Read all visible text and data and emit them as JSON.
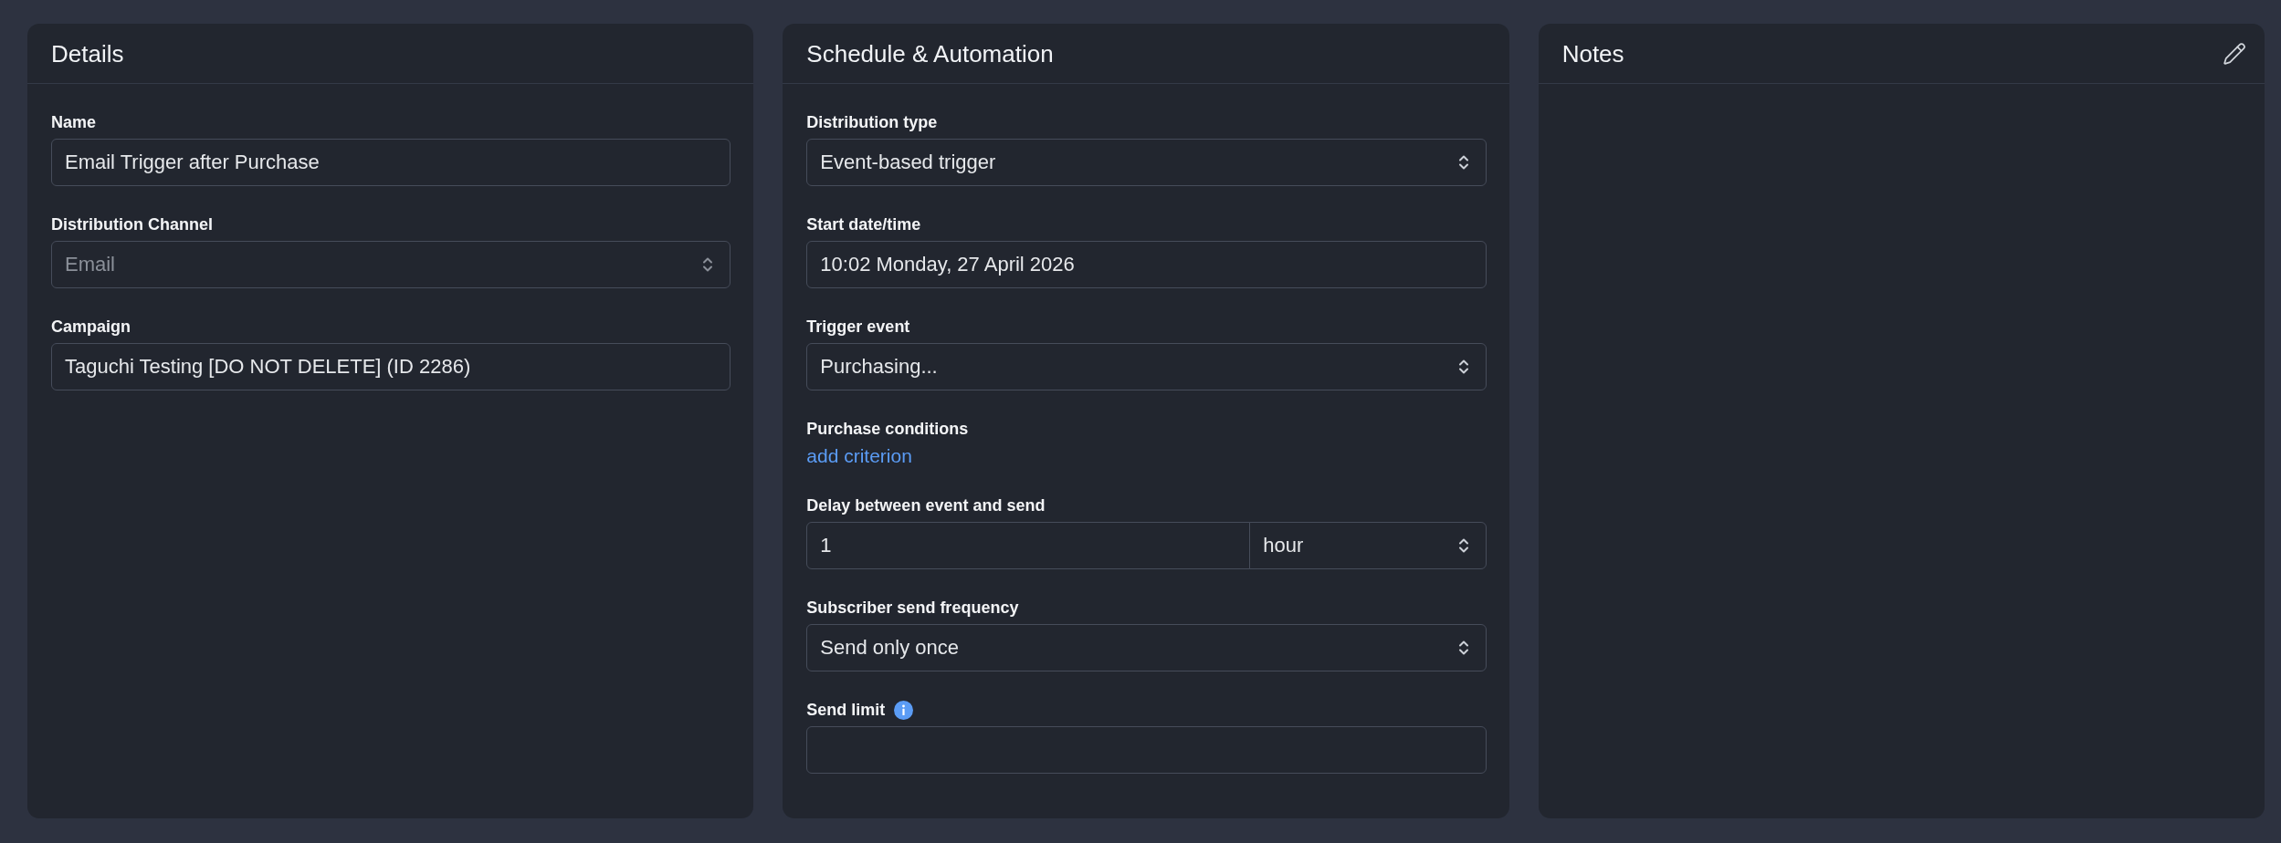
{
  "panels": [
    {
      "title": "Details",
      "editable": false,
      "fields": [
        {
          "kind": "text",
          "label": "Name",
          "value": "Email Trigger after Purchase",
          "disabled": false,
          "info": false
        },
        {
          "kind": "select",
          "label": "Distribution Channel",
          "value": "Email",
          "disabled": true,
          "info": false
        },
        {
          "kind": "text",
          "label": "Campaign",
          "value": "Taguchi Testing [DO NOT DELETE] (ID 2286)",
          "disabled": false,
          "info": false
        }
      ]
    },
    {
      "title": "Schedule & Automation",
      "editable": false,
      "fields": [
        {
          "kind": "select",
          "label": "Distribution type",
          "value": "Event-based trigger",
          "disabled": false,
          "info": false
        },
        {
          "kind": "text",
          "label": "Start date/time",
          "value": "10:02 Monday, 27 April 2026",
          "disabled": false,
          "info": false
        },
        {
          "kind": "select",
          "label": "Trigger event",
          "value": "Purchasing...",
          "disabled": false,
          "info": false
        },
        {
          "kind": "link",
          "label": "Purchase conditions",
          "link": "add criterion",
          "disabled": false,
          "info": false
        },
        {
          "kind": "delay",
          "label": "Delay between event and send",
          "value": "1",
          "unit": "hour",
          "disabled": false,
          "info": false
        },
        {
          "kind": "select",
          "label": "Subscriber send frequency",
          "value": "Send only once",
          "disabled": false,
          "info": false
        },
        {
          "kind": "text",
          "label": "Send limit",
          "disabled": false,
          "info": true
        }
      ]
    },
    {
      "title": "Notes",
      "editable": true
    }
  ]
}
